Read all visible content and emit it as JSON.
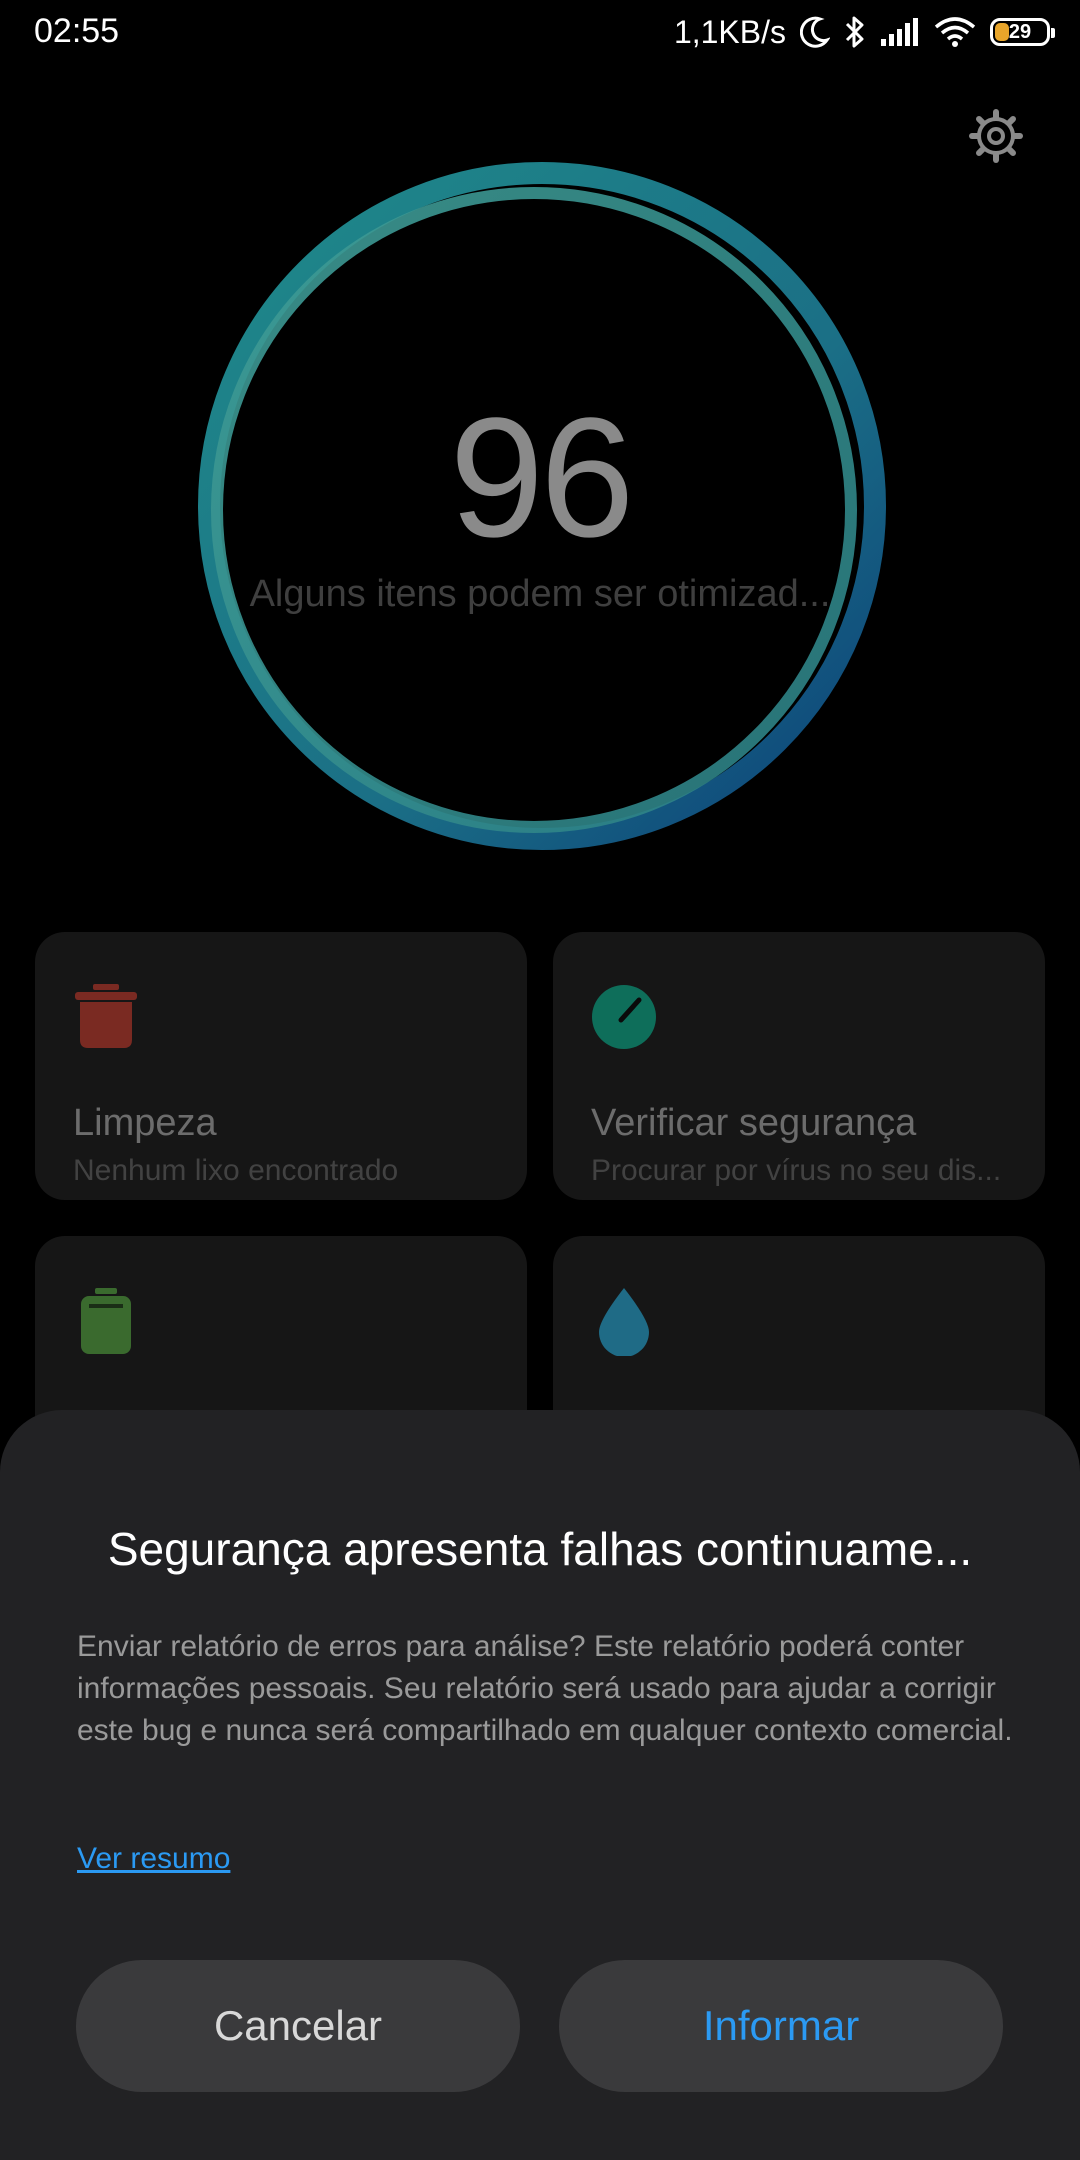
{
  "status_bar": {
    "time": "02:55",
    "net_speed": "1,1KB/s",
    "battery": "29",
    "icons": [
      "moon-icon",
      "bluetooth-icon",
      "signal-icon",
      "wifi-icon",
      "battery-icon"
    ]
  },
  "header": {
    "settings_icon": "gear-icon"
  },
  "score": {
    "value": "96",
    "subtitle": "Alguns itens podem ser otimizad..."
  },
  "cards": [
    {
      "icon": "trash-icon",
      "title": "Limpeza",
      "subtitle": "Nenhum lixo encontrado",
      "icon_color": "#7a2a22"
    },
    {
      "icon": "gauge-icon",
      "title": "Verificar segurança",
      "subtitle": "Procurar por vírus no seu dis...",
      "icon_color": "#0e6e5a"
    },
    {
      "icon": "battery-icon",
      "title": "",
      "subtitle": "",
      "icon_color": "#3a6a2e"
    },
    {
      "icon": "drop-icon",
      "title": "",
      "subtitle": "",
      "icon_color": "#1f6b86"
    }
  ],
  "dialog": {
    "title": "Segurança apresenta falhas continuame...",
    "body": "Enviar relatório de erros para análise? Este relatório poderá conter informações pessoais. Seu relatório será usado para ajudar a corrigir este bug e nunca será compartilhado em qualquer contexto comercial.",
    "link": "Ver resumo",
    "cancel_label": "Cancelar",
    "report_label": "Informar",
    "accent_color": "#2b9af3"
  }
}
